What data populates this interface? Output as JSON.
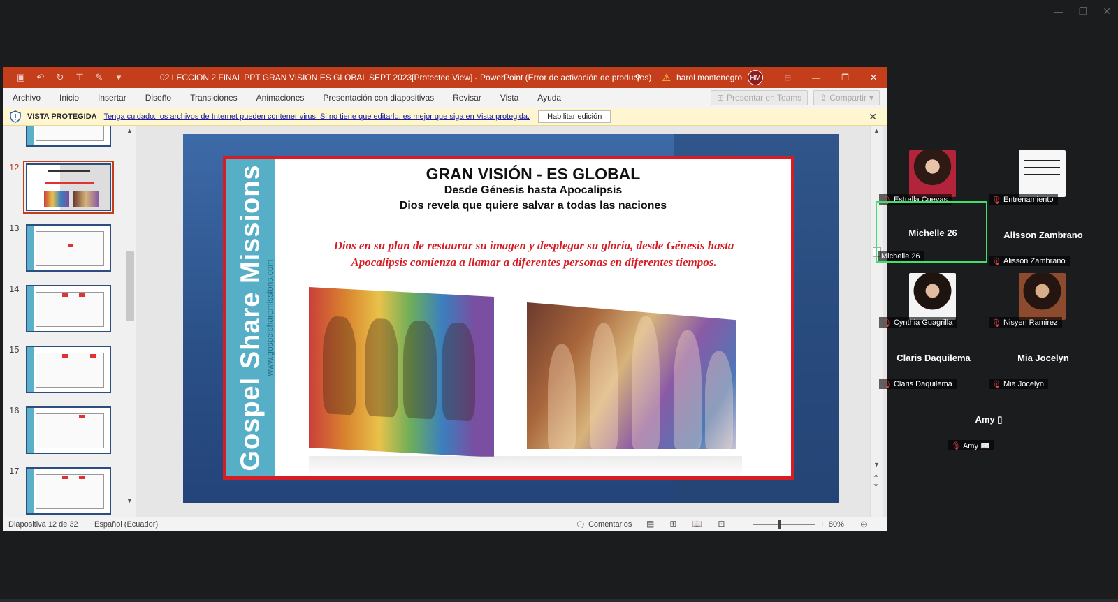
{
  "window": {
    "title": "02 LECCION 2 FINAL PPT GRAN VISION ES GLOBAL SEPT 2023[Protected View]  -  PowerPoint (Error de activación de productos)",
    "user": "harol montenegro",
    "user_initials": "HM"
  },
  "menu": [
    "Archivo",
    "Inicio",
    "Insertar",
    "Diseño",
    "Transiciones",
    "Animaciones",
    "Presentación con diapositivas",
    "Revisar",
    "Vista",
    "Ayuda"
  ],
  "menu_buttons": {
    "teams": "Presentar en Teams",
    "share": "Compartir"
  },
  "protected": {
    "title": "VISTA PROTEGIDA",
    "message": "Tenga cuidado: los archivos de Internet pueden contener virus. Si no tiene que editarlo, es mejor que siga en Vista protegida.",
    "button": "Habilitar edición"
  },
  "thumbnails": [
    {
      "num": ""
    },
    {
      "num": "12",
      "active": true
    },
    {
      "num": "13"
    },
    {
      "num": "14"
    },
    {
      "num": "15"
    },
    {
      "num": "16"
    },
    {
      "num": "17"
    }
  ],
  "slide": {
    "title": "GRAN VISIÓN - ES GLOBAL",
    "subtitle1": "Desde Génesis hasta Apocalipsis",
    "subtitle2": "Dios revela que quiere salvar a todas las naciones",
    "quote": "Dios en su plan de restaurar su imagen y desplegar su gloria, desde Génesis hasta Apocalipsis comienza a llamar a diferentes personas en diferentes tiempos.",
    "side_text": "Gospel Share Missions",
    "side_url": "www.gospelsharemissions.com"
  },
  "status": {
    "slide_info": "Diapositiva 12 de 32",
    "language": "Español (Ecuador)",
    "comments": "Comentarios",
    "zoom": "80%"
  },
  "participants": [
    {
      "name": "Estrella Cuevas",
      "type": "photo"
    },
    {
      "name": "Entrenamiento",
      "type": "logo"
    },
    {
      "name": "Michelle 26",
      "display": "Michelle 26",
      "type": "name",
      "active": true
    },
    {
      "name": "Alisson Zambrano",
      "display": "Alisson Zambrano",
      "type": "name"
    },
    {
      "name": "Cynthia Guagrilla",
      "type": "photo"
    },
    {
      "name": "Nisyen Ramirez",
      "type": "photo"
    },
    {
      "name": "Claris Daquilema",
      "display": "Claris Daquilema",
      "type": "name"
    },
    {
      "name": "Mia Jocelyn",
      "display": "Mia Jocelyn",
      "type": "name"
    },
    {
      "name": "Amy 📖",
      "display": "Amy ▯",
      "type": "name"
    }
  ]
}
